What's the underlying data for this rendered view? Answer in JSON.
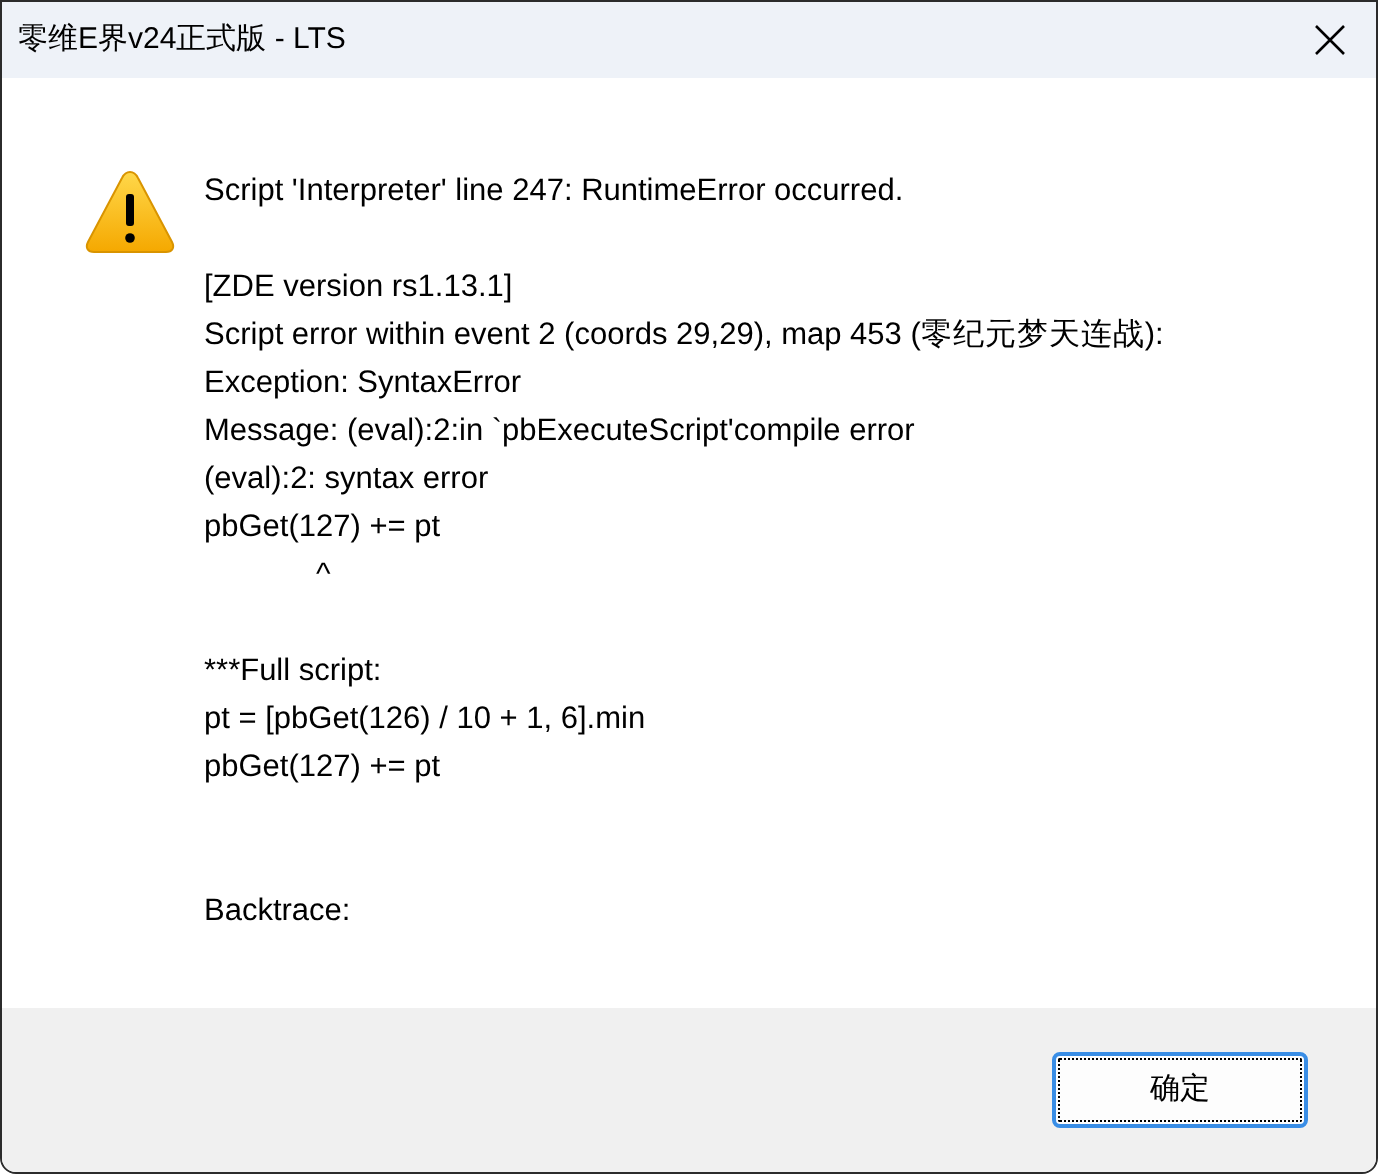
{
  "window": {
    "title": "零维E界v24正式版 - LTS"
  },
  "message": "Script 'Interpreter' line 247: RuntimeError occurred.\n\n[ZDE version rs1.13.1]\nScript error within event 2 (coords 29,29), map 453 (零纪元梦天连战):\nException: SyntaxError\nMessage: (eval):2:in `pbExecuteScript'compile error\n(eval):2: syntax error\npbGet(127) += pt\n             ^\n\n***Full script:\npt = [pbGet(126) / 10 + 1, 6].min\npbGet(127) += pt\n\n\nBacktrace:",
  "buttons": [
    {
      "label": "确定",
      "focused": true
    }
  ]
}
